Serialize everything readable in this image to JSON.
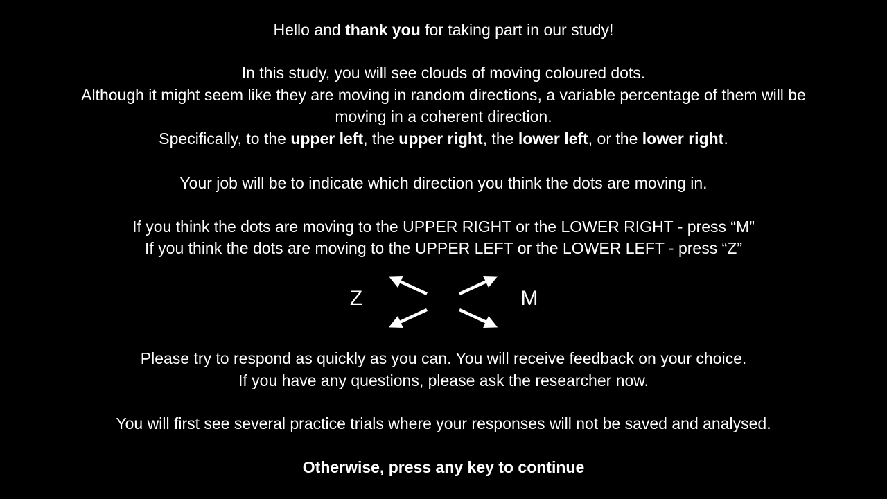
{
  "instructions": {
    "greeting": {
      "pre": "Hello and ",
      "bold": "thank you",
      "post": " for taking part in our study!"
    },
    "intro_line1": "In this study, you will see clouds of moving coloured dots.",
    "intro_line2": "Although it might seem like they are moving in random directions, a variable percentage of them will be",
    "intro_line3": "moving in a coherent direction.",
    "directions": {
      "prefix": "Specifically, to the ",
      "upper_left": "upper left",
      "sep1": ", the ",
      "upper_right": "upper right",
      "sep2": ", the ",
      "lower_left": "lower left",
      "sep3": ", or the ",
      "lower_right": "lower right",
      "suffix": "."
    },
    "job": "Your job will be to indicate which direction you think the dots are moving in.",
    "rule_m": "If you think the dots are moving to the UPPER RIGHT or the LOWER RIGHT - press “M”",
    "rule_z": "If you think the dots are moving to the UPPER LEFT or the LOWER LEFT - press “Z”",
    "diagram": {
      "left_key": "Z",
      "right_key": "M",
      "left_arrows_icon": "arrows-left-icon",
      "right_arrows_icon": "arrows-right-icon"
    },
    "respond_quickly": "Please try to respond as quickly as you can. You will receive feedback on your choice.",
    "questions": "If you have any questions, please ask the researcher now.",
    "practice": "You will first see several practice trials where your responses will not be saved and analysed.",
    "continue_prompt": "Otherwise, press any key to continue"
  },
  "colors": {
    "background": "#000000",
    "text": "#ffffff"
  }
}
